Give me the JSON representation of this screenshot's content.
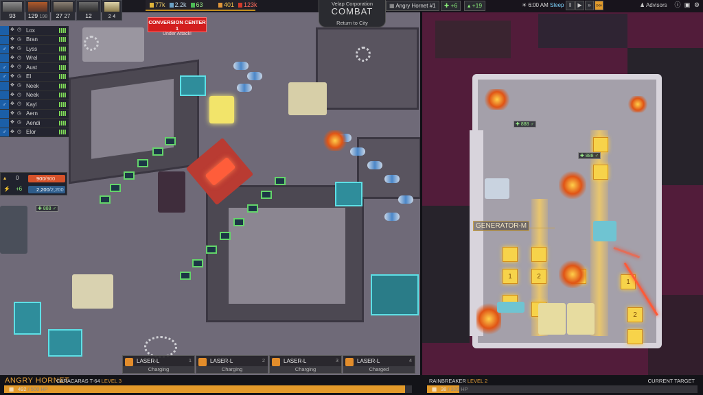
{
  "crew_stats": [
    {
      "value": "93"
    },
    {
      "value": "129",
      "sub": "198"
    },
    {
      "value": "27",
      "sub": "27"
    },
    {
      "value": "12"
    },
    {
      "value": "2",
      "sub": "4"
    }
  ],
  "resources": {
    "credits": "77k",
    "materials": "2.2k",
    "supplies": "63",
    "crew": "401",
    "cost": "123k"
  },
  "combat_banner": {
    "corporation": "Velap Corporation",
    "title": "COMBAT",
    "return_label": "Return to City"
  },
  "ship_selector": {
    "value": "Angry Hornet #1",
    "stat_a": "+6",
    "stat_b": "+19"
  },
  "clock": {
    "time": "6:00 AM",
    "status": "Sleep"
  },
  "speed_controls": [
    {
      "glyph": "‖",
      "active": false
    },
    {
      "glyph": "▶",
      "active": false
    },
    {
      "glyph": "»",
      "active": false
    },
    {
      "glyph": "»»",
      "active": true
    }
  ],
  "advisors_label": "Advisors",
  "alert": {
    "title": "CONVERSION CENTER 1",
    "subtitle": "Under Attack!"
  },
  "crew_list": [
    {
      "name": "Lox",
      "mark": ""
    },
    {
      "name": "Bran",
      "mark": ""
    },
    {
      "name": "Lyss",
      "mark": "♂"
    },
    {
      "name": "Wrel",
      "mark": ""
    },
    {
      "name": "Aust",
      "mark": "♂"
    },
    {
      "name": "El",
      "mark": "♂"
    },
    {
      "name": "Neek",
      "mark": ""
    },
    {
      "name": "Neek",
      "mark": ""
    },
    {
      "name": "Kayl",
      "mark": "♂"
    },
    {
      "name": "Aern",
      "mark": ""
    },
    {
      "name": "Aendi",
      "mark": ""
    },
    {
      "name": "Elor",
      "mark": "♂"
    }
  ],
  "power": {
    "zero": "0",
    "hull_value": "900",
    "hull_max": "/900",
    "regen": "+6",
    "shield_value": "2,200",
    "shield_max": "/2,200"
  },
  "room_tag": "888",
  "weapons": [
    {
      "name": "LASER-L",
      "slot": "1",
      "status": "Charging",
      "progress": 0.05
    },
    {
      "name": "LASER-L",
      "slot": "2",
      "status": "Charging",
      "progress": 0.0
    },
    {
      "name": "LASER-L",
      "slot": "3",
      "status": "Charging",
      "progress": 0.0
    },
    {
      "name": "LASER-L",
      "slot": "4",
      "status": "Charged",
      "progress": 0.0
    }
  ],
  "player_ship": {
    "name": "ANGRY HORNET",
    "class": "CARACARAS T-64",
    "level": "LEVEL 3",
    "hp": "492",
    "hp_max": "/ 500 HP",
    "hp_fraction": 0.984
  },
  "enemy_ship": {
    "name": "RAINBREAKER",
    "level": "LEVEL 2",
    "hp": "38",
    "hp_max": "/ 320 HP",
    "hp_fraction": 0.119,
    "target_label": "CURRENT TARGET",
    "room_label": "GENERATOR-M",
    "cell_numbers": [
      "1",
      "2",
      "3",
      "1",
      "2"
    ]
  },
  "colors": {
    "accent_orange": "#e8a23a",
    "alert_red": "#d31e1e",
    "health_green": "#7ed957",
    "crew_blue": "#1b5fa8"
  }
}
